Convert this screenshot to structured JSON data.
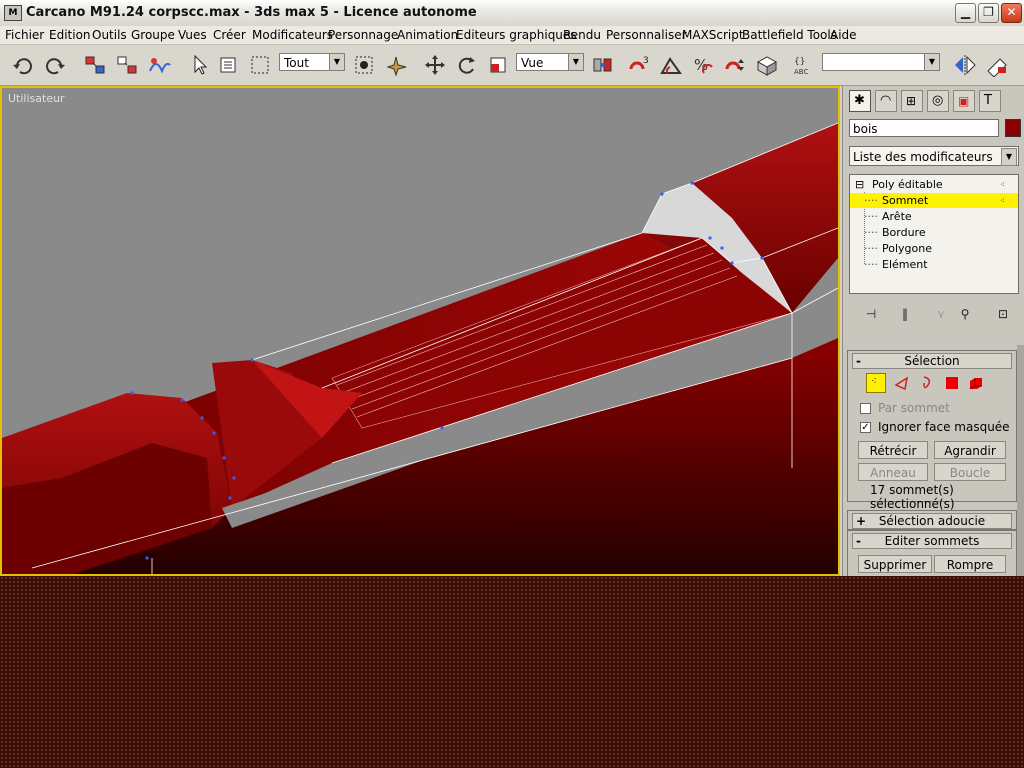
{
  "window": {
    "title": "Carcano M91.24 corpscc.max - 3ds max 5 - Licence autonome",
    "app_icon_text": "M",
    "minimize_icon": "minimize-icon",
    "maximize_icon": "maximize-icon",
    "close_icon": "close-icon"
  },
  "menu": {
    "items": [
      "Fichier",
      "Edition",
      "Outils",
      "Groupe",
      "Vues",
      "Créer",
      "Modificateurs",
      "Personnage",
      "Animation",
      "Editeurs graphiques",
      "Rendu",
      "Personnaliser",
      "MAXScript",
      "Battlefield Tools",
      "Aide"
    ]
  },
  "toolbar": {
    "selection_filter": "Tout",
    "ref_coord": "Vue",
    "named_selection": ""
  },
  "viewport": {
    "label": "Utilisateur",
    "background_color": "#8a8a8a",
    "border_color": "#e0c000",
    "model_color": "#8a0000"
  },
  "command_panel": {
    "object_name": "bois",
    "object_color": "#8a0000",
    "modifier_list": "Liste des modificateurs",
    "stack": {
      "root": "Poly éditable",
      "root_expander": "⊟",
      "subobjects": [
        "Sommet",
        "Arête",
        "Bordure",
        "Polygone",
        "Elément"
      ],
      "selected_index": 0
    },
    "selection_rollout": {
      "title": "Sélection",
      "toggle": "-",
      "by_vertex_label": "Par sommet",
      "ignore_backfacing_label": "Ignorer face masquée",
      "ignore_backfacing_checked": "✓",
      "shrink": "Rétrécir",
      "grow": "Agrandir",
      "ring": "Anneau",
      "loop": "Boucle",
      "status": "17 sommet(s) sélectionné(s)"
    },
    "soft_selection_rollout": {
      "title": "Sélection adoucie",
      "toggle": "+"
    },
    "edit_vertices_rollout": {
      "title": "Editer sommets",
      "toggle": "-",
      "remove": "Supprimer",
      "break": "Rompre"
    }
  }
}
